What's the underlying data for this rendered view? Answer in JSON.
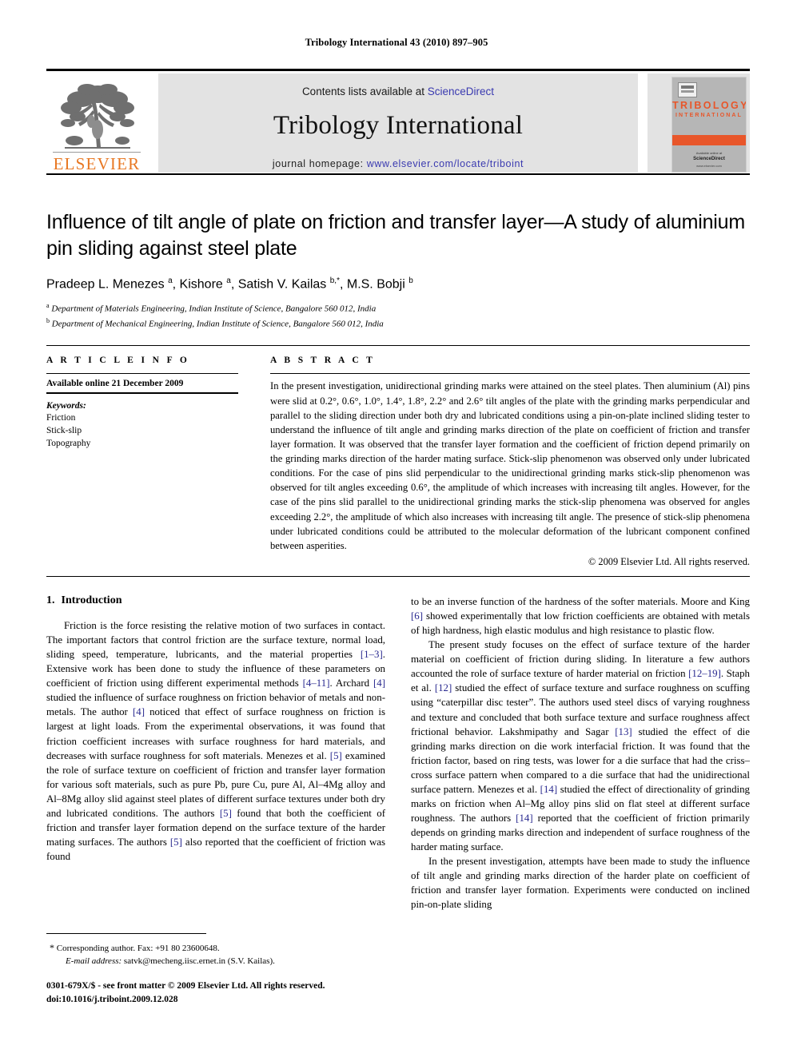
{
  "running_head": "Tribology International 43 (2010) 897–905",
  "masthead": {
    "contents_prefix": "Contents lists available at ",
    "sciencedirect": "ScienceDirect",
    "journal_title": "Tribology International",
    "homepage_label": "journal homepage: ",
    "homepage_url": "www.elsevier.com/locate/triboint",
    "publisher_wordmark": "ELSEVIER",
    "publisher_color": "#E87722",
    "link_color": "#3a3ab0"
  },
  "cover": {
    "line1": "TRIBOLOGY",
    "line2": "INTERNATIONAL",
    "foot_small": "Available online at",
    "foot_brand": "ScienceDirect",
    "foot_url": "www.elsevier.com",
    "accent_color": "#E8562A",
    "bg_color": "#b6b6b6"
  },
  "article": {
    "title": "Influence of tilt angle of plate on friction and transfer layer—A study of aluminium pin sliding against steel plate",
    "authors_html": "Pradeep L. Menezes <sup>a</sup>, Kishore <sup>a</sup>, Satish V. Kailas <sup>b,*</sup>, M.S. Bobji <sup>b</sup>",
    "affiliation_a": "Department of Materials Engineering, Indian Institute of Science, Bangalore 560 012, India",
    "affiliation_b": "Department of Mechanical Engineering, Indian Institute of Science, Bangalore 560 012, India",
    "affil_a_marker": "a",
    "affil_b_marker": "b"
  },
  "article_info": {
    "heading": "A R T I C L E  I N F O",
    "history": "Available online 21 December 2009",
    "keywords_label": "Keywords:",
    "keywords": [
      "Friction",
      "Stick-slip",
      "Topography"
    ]
  },
  "abstract": {
    "heading": "A B S T R A C T",
    "text": "In the present investigation, unidirectional grinding marks were attained on the steel plates. Then aluminium (Al) pins were slid at 0.2°, 0.6°, 1.0°, 1.4°, 1.8°, 2.2° and 2.6° tilt angles of the plate with the grinding marks perpendicular and parallel to the sliding direction under both dry and lubricated conditions using a pin-on-plate inclined sliding tester to understand the influence of tilt angle and grinding marks direction of the plate on coefficient of friction and transfer layer formation. It was observed that the transfer layer formation and the coefficient of friction depend primarily on the grinding marks direction of the harder mating surface. Stick-slip phenomenon was observed only under lubricated conditions. For the case of pins slid perpendicular to the unidirectional grinding marks stick-slip phenomenon was observed for tilt angles exceeding 0.6°, the amplitude of which increases with increasing tilt angles. However, for the case of the pins slid parallel to the unidirectional grinding marks the stick-slip phenomena was observed for angles exceeding 2.2°, the amplitude of which also increases with increasing tilt angle. The presence of stick-slip phenomena under lubricated conditions could be attributed to the molecular deformation of the lubricant component confined between asperities.",
    "copyright": "© 2009 Elsevier Ltd. All rights reserved."
  },
  "body": {
    "section_number": "1.",
    "section_title": "Introduction",
    "left_paragraphs": [
      "Friction is the force resisting the relative motion of two surfaces in contact. The important factors that control friction are the surface texture, normal load, sliding speed, temperature, lubricants, and the material properties [1–3]. Extensive work has been done to study the influence of these parameters on coefficient of friction using different experimental methods [4–11]. Archard [4] studied the influence of surface roughness on friction behavior of metals and non-metals. The author [4] noticed that effect of surface roughness on friction is largest at light loads. From the experimental observations, it was found that friction coefficient increases with surface roughness for hard materials, and decreases with surface roughness for soft materials. Menezes et al. [5] examined the role of surface texture on coefficient of friction and transfer layer formation for various soft materials, such as pure Pb, pure Cu, pure Al, Al–4Mg alloy and Al–8Mg alloy slid against steel plates of different surface textures under both dry and lubricated conditions. The authors [5] found that both the coefficient of friction and transfer layer formation depend on the surface texture of the harder mating surfaces. The authors [5] also reported that the coefficient of friction was found"
    ],
    "right_paragraphs": [
      "to be an inverse function of the hardness of the softer materials. Moore and King [6] showed experimentally that low friction coefficients are obtained with metals of high hardness, high elastic modulus and high resistance to plastic flow.",
      "The present study focuses on the effect of surface texture of the harder material on coefficient of friction during sliding. In literature a few authors accounted the role of surface texture of harder material on friction [12–19]. Staph et al. [12] studied the effect of surface texture and surface roughness on scuffing using “caterpillar disc tester”. The authors used steel discs of varying roughness and texture and concluded that both surface texture and surface roughness affect frictional behavior. Lakshmipathy and Sagar [13] studied the effect of die grinding marks direction on die work interfacial friction. It was found that the friction factor, based on ring tests, was lower for a die surface that had the criss–cross surface pattern when compared to a die surface that had the unidirectional surface pattern. Menezes et al. [14] studied the effect of directionality of grinding marks on friction when Al–Mg alloy pins slid on flat steel at different surface roughness. The authors [14] reported that the coefficient of friction primarily depends on grinding marks direction and independent of surface roughness of the harder mating surface.",
      "In the present investigation, attempts have been made to study the influence of tilt angle and grinding marks direction of the harder plate on coefficient of friction and transfer layer formation. Experiments were conducted on inclined pin-on-plate sliding"
    ],
    "citation_color": "#29298f"
  },
  "footnotes": {
    "corresponding": "Corresponding author. Fax: +91 80 23600648.",
    "corresponding_marker": "*",
    "email_label": "E-mail address:",
    "email_value": "satvk@mecheng.iisc.ernet.in (S.V. Kailas).",
    "issn_line": "0301-679X/$ - see front matter © 2009 Elsevier Ltd. All rights reserved.",
    "doi_line": "doi:10.1016/j.triboint.2009.12.028"
  }
}
